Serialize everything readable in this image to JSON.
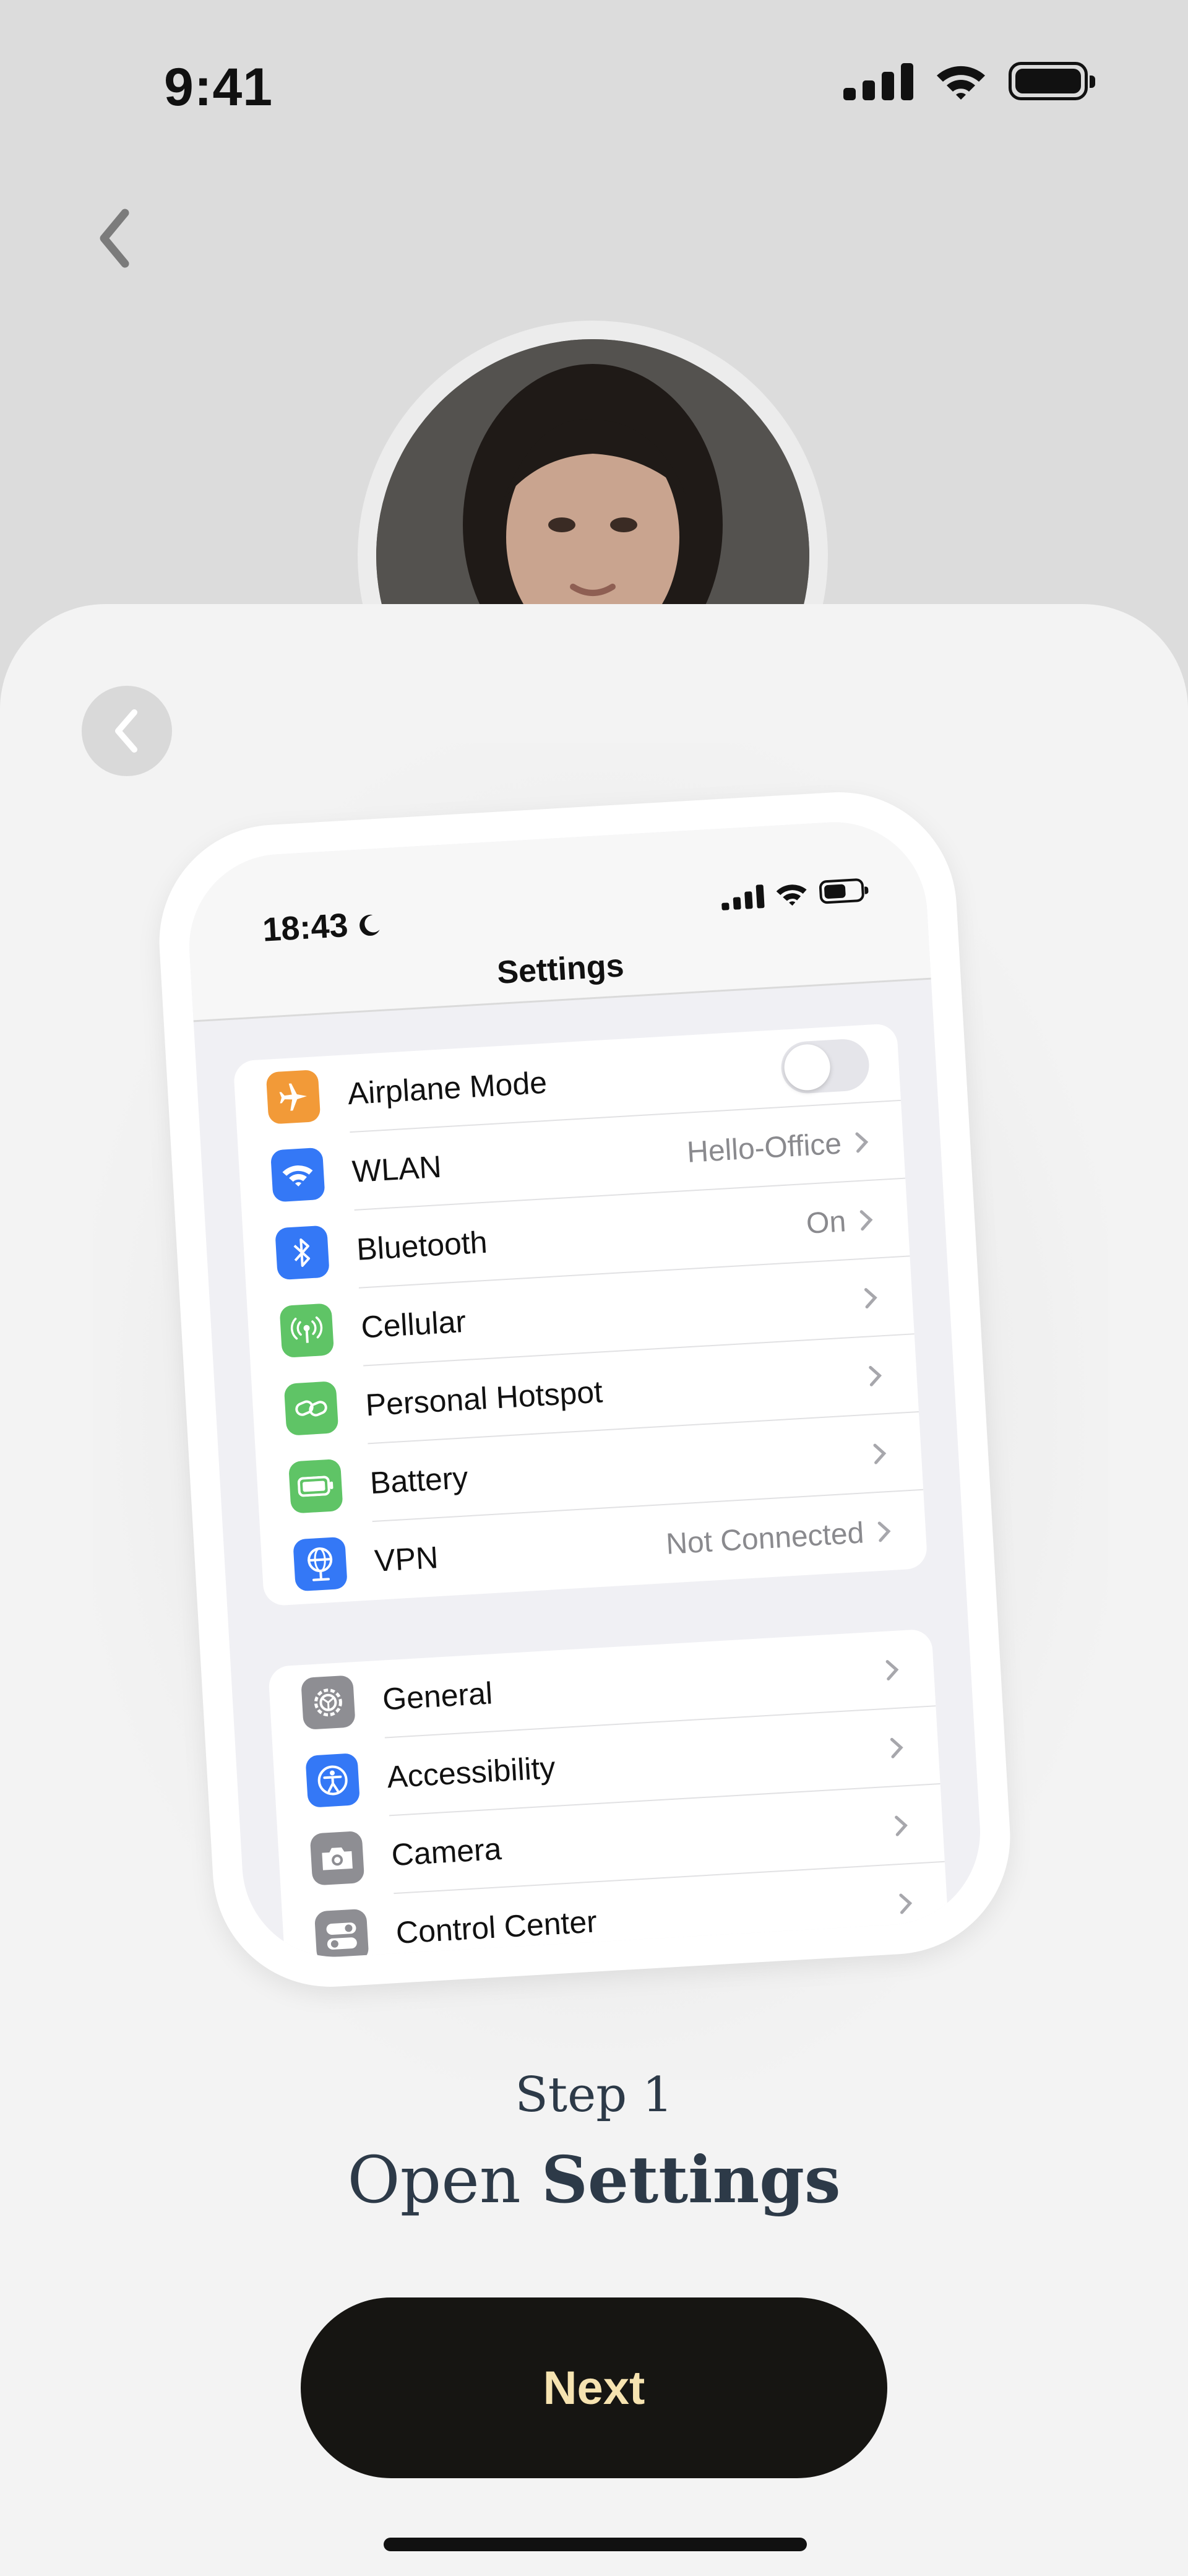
{
  "status_bar": {
    "time": "9:41"
  },
  "phone_preview": {
    "time": "18:43",
    "title": "Settings",
    "group1": [
      {
        "label": "Airplane Mode",
        "value": "",
        "icon": "airplane-icon",
        "color": "#f29a38",
        "control": "toggle-off"
      },
      {
        "label": "WLAN",
        "value": "Hello-Office",
        "icon": "wifi-icon",
        "color": "#3478f6"
      },
      {
        "label": "Bluetooth",
        "value": "On",
        "icon": "bluetooth-icon",
        "color": "#3478f6"
      },
      {
        "label": "Cellular",
        "value": "",
        "icon": "antenna-icon",
        "color": "#5fc466"
      },
      {
        "label": "Personal Hotspot",
        "value": "",
        "icon": "link-icon",
        "color": "#5fc466"
      },
      {
        "label": "Battery",
        "value": "",
        "icon": "battery-icon",
        "color": "#5fc466"
      },
      {
        "label": "VPN",
        "value": "Not Connected",
        "icon": "globe-icon",
        "color": "#3478f6"
      }
    ],
    "group2": [
      {
        "label": "General",
        "icon": "gear-icon",
        "color": "#8e8e93"
      },
      {
        "label": "Accessibility",
        "icon": "accessibility-icon",
        "color": "#3478f6"
      },
      {
        "label": "Camera",
        "icon": "camera-icon",
        "color": "#8e8e93"
      },
      {
        "label": "Control Center",
        "icon": "toggles-icon",
        "color": "#8e8e93"
      }
    ]
  },
  "step": {
    "label": "Step 1",
    "title_prefix": "Open ",
    "title_bold": "Settings"
  },
  "next_button": {
    "label": "Next"
  },
  "colors": {
    "button_bg": "#161512",
    "button_text": "#f6e3b0",
    "heading": "#2d3a48"
  }
}
